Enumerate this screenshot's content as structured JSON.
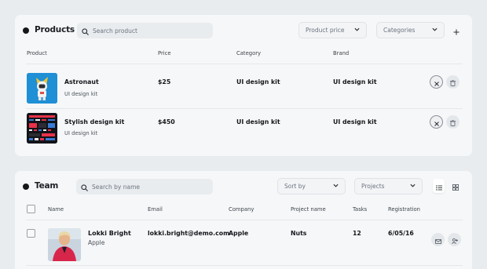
{
  "products": {
    "title": "Products",
    "search_placeholder": "Search product",
    "filters": {
      "price": "Product price",
      "categories": "Categories"
    },
    "columns": [
      "Product",
      "Price",
      "Category",
      "Brand"
    ],
    "rows": [
      {
        "name": "Astronaut",
        "subtitle": "UI design kit",
        "price": "$25",
        "category": "UI design kit",
        "brand": "UI design kit"
      },
      {
        "name": "Stylish design kit",
        "subtitle": "UI design kit",
        "price": "$450",
        "category": "UI design kit",
        "brand": "UI design kit"
      }
    ]
  },
  "team": {
    "title": "Team",
    "search_placeholder": "Search by name",
    "filters": {
      "sort": "Sort by",
      "projects": "Projects"
    },
    "columns": [
      "Name",
      "Email",
      "Company",
      "Project name",
      "Tasks",
      "Registration"
    ],
    "rows": [
      {
        "name": "Lokki Bright",
        "company_sub": "Apple",
        "email": "lokki.bright@demo.com",
        "company": "Apple",
        "project": "Nuts",
        "tasks": "12",
        "registration": "6/05/16"
      }
    ]
  },
  "icons": {
    "search": "search-icon",
    "chevron": "chevron-down-icon",
    "plus": "plus-icon",
    "close": "close-icon",
    "trash": "trash-icon",
    "list": "list-view-icon",
    "grid": "grid-view-icon",
    "mail": "mail-icon",
    "add_user": "add-user-icon"
  },
  "colors": {
    "background": "#e8ecef",
    "card": "#f6f7f8",
    "accent_dark": "#15171b",
    "astronaut_bg": "#1f8fd6"
  }
}
